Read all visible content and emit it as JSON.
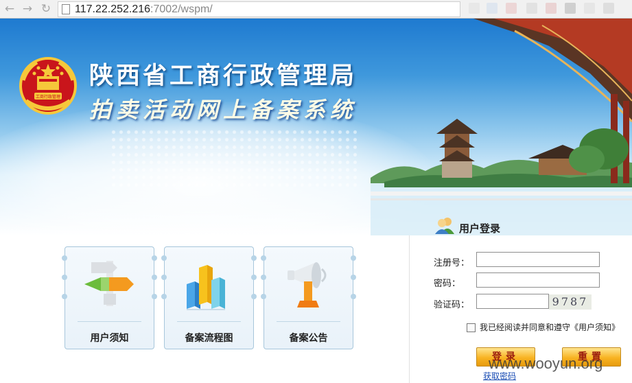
{
  "browser": {
    "url_host": "117.22.252.216",
    "url_path": ":7002/wspm/"
  },
  "banner": {
    "title_line1": "陕西省工商行政管理局",
    "title_line2": "拍卖活动网上备案系统",
    "emblem_text": "工商行政管理"
  },
  "quick_links": [
    {
      "label": "用户须知",
      "icon": "signpost-icon"
    },
    {
      "label": "备案流程图",
      "icon": "bar-chart-icon"
    },
    {
      "label": "备案公告",
      "icon": "megaphone-icon"
    }
  ],
  "login": {
    "title": "用户登录",
    "username_label": "注册号：",
    "password_label": "密码：",
    "captcha_label": "验证码：",
    "captcha_value": "9787",
    "agree_text": "我已经阅读并同意和遵守《用户须知》",
    "login_button": "登录",
    "reset_button": "重置",
    "get_password_link": "获取密码"
  },
  "watermark": "www.wooyun.org"
}
